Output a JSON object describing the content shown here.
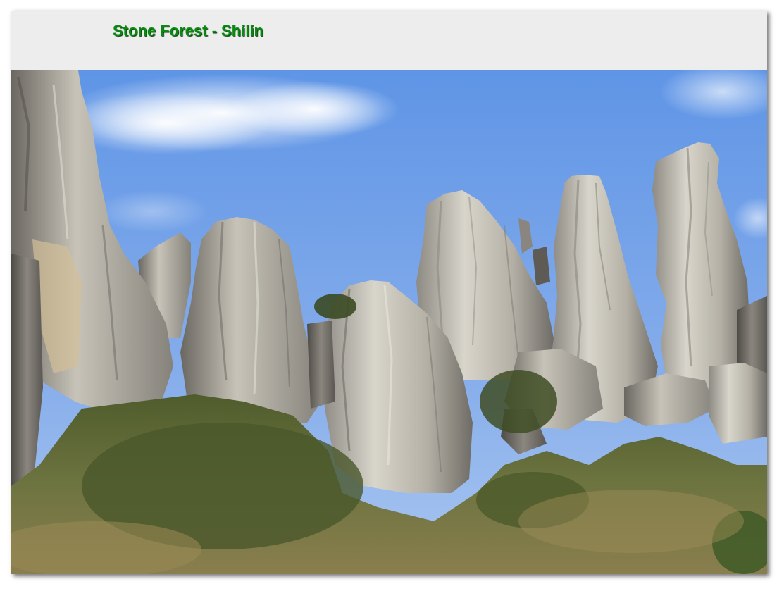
{
  "header": {
    "title": "Stone Forest - Shilin"
  },
  "photo": {
    "subject": "karst limestone pinnacles under blue sky",
    "colors": {
      "sky_top": "#5f95e6",
      "sky_bottom": "#9cc0f0",
      "rock_light": "#d9d6cc",
      "rock_mid": "#a9a59b",
      "rock_dark": "#5e5b55",
      "grass": "#6b7a3a",
      "grass_dry": "#a59460",
      "title_green": "#0a8a12"
    }
  }
}
